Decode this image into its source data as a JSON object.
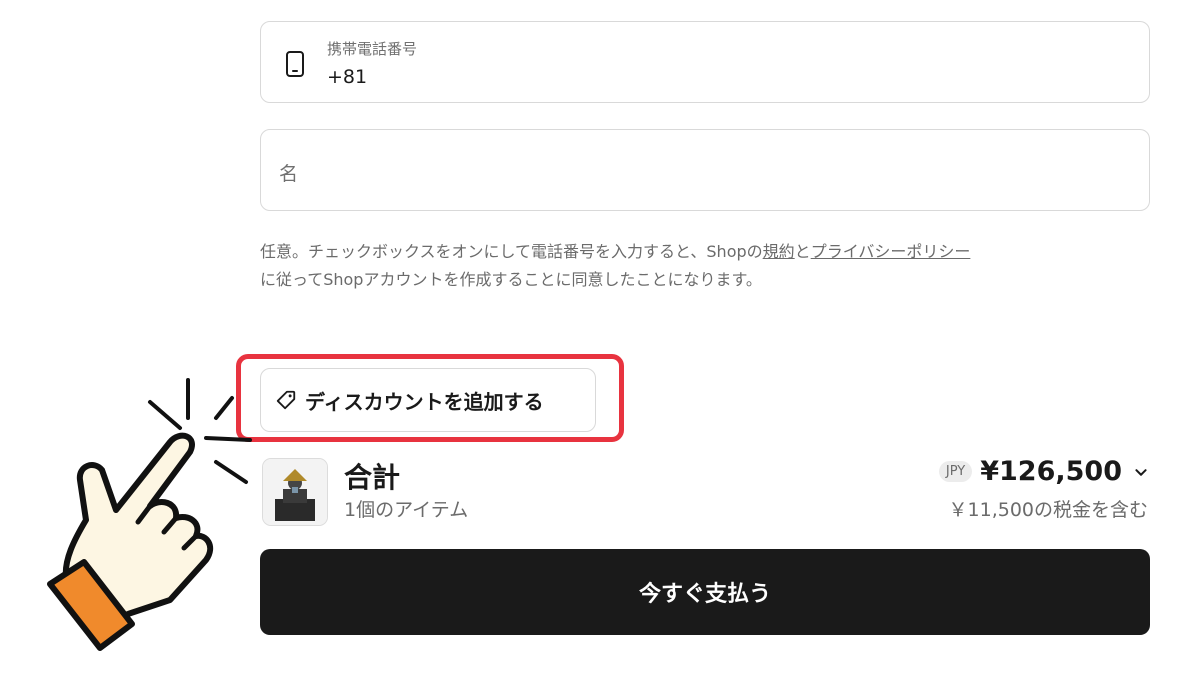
{
  "form": {
    "phone": {
      "label": "携帯電話番号",
      "value": "+81"
    },
    "name": {
      "placeholder": "名"
    },
    "notice": {
      "line1_prefix": "任意。チェックボックスをオンにして電話番号を入力すると、Shopの",
      "terms_link": "規約",
      "and": "と",
      "privacy_link": "プライバシーポリシー",
      "line2": "に従ってShopアカウントを作成することに同意したことになります。"
    }
  },
  "discount": {
    "label": "ディスカウントを追加する",
    "icon": "tag-icon"
  },
  "summary": {
    "total_label": "合計",
    "item_count": "1個のアイテム",
    "currency_code": "JPY",
    "total_price": "¥126,500",
    "tax_note": "￥11,500の税金を含む"
  },
  "pay_button": {
    "label": "今すぐ支払う"
  },
  "colors": {
    "accent_highlight": "#e8333f",
    "pay_button_bg": "#1a1a1a",
    "hand_cuff": "#f08a2c",
    "hand_skin": "#fdf6e3"
  }
}
